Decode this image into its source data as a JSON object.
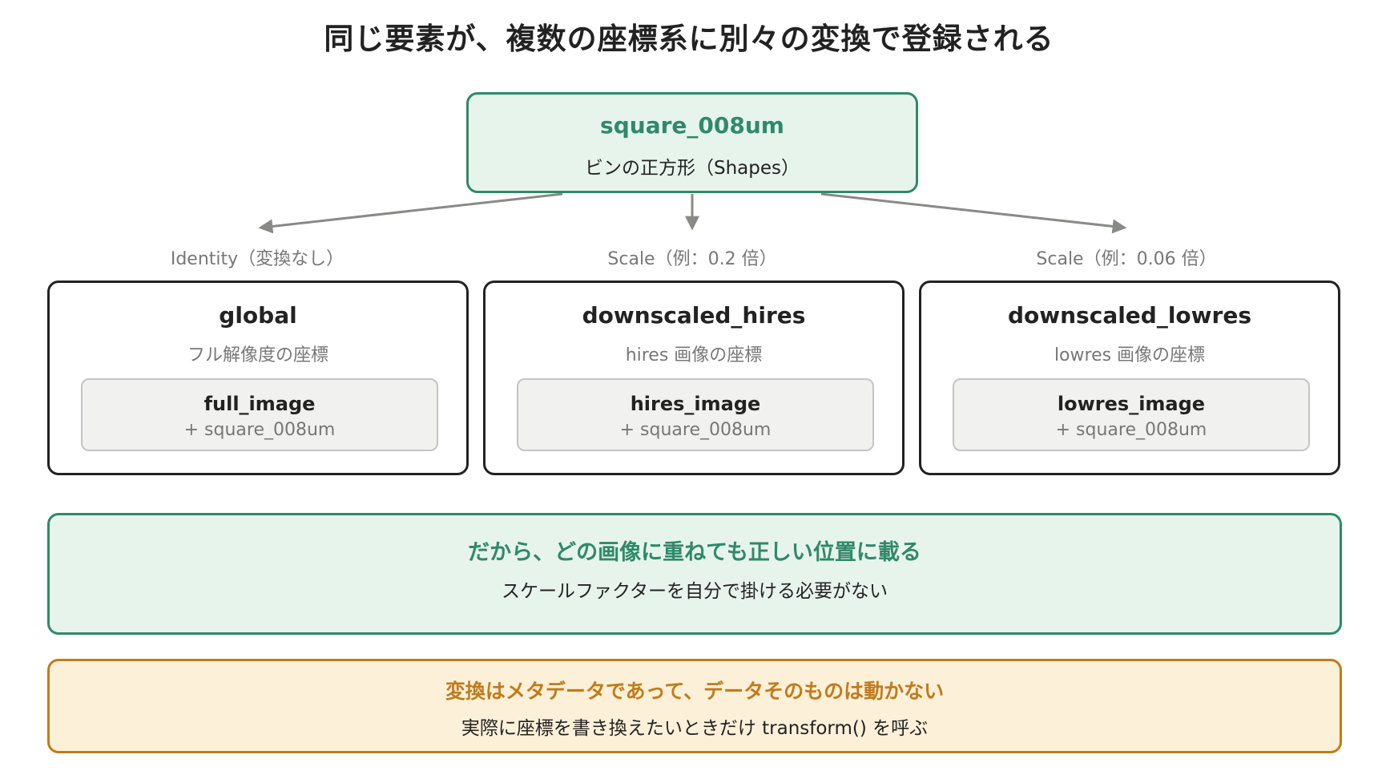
{
  "title": "同じ要素が、複数の座標系に別々の変換で登録される",
  "source": {
    "name": "square_008um",
    "description": "ビンの正方形（Shapes）"
  },
  "transforms": [
    {
      "label": "Identity（変換なし）"
    },
    {
      "label": "Scale（例：0.2 倍）"
    },
    {
      "label": "Scale（例：0.06 倍）"
    }
  ],
  "coordinate_systems": [
    {
      "name": "global",
      "description": "フル解像度の座標",
      "image": "full_image",
      "shape": "+ square_008um"
    },
    {
      "name": "downscaled_hires",
      "description": "hires 画像の座標",
      "image": "hires_image",
      "shape": "+ square_008um"
    },
    {
      "name": "downscaled_lowres",
      "description": "lowres 画像の座標",
      "image": "lowres_image",
      "shape": "+ square_008um"
    }
  ],
  "callout_green": {
    "title": "だから、どの画像に重ねても正しい位置に載る",
    "subtitle": "スケールファクターを自分で掛ける必要がない"
  },
  "callout_orange": {
    "title": "変換はメタデータであって、データそのものは動かない",
    "subtitle": "実際に座標を書き換えたいときだけ transform() を呼ぶ"
  },
  "colors": {
    "accent_green": "#2e8a6a",
    "green_fill": "#e7f4ec",
    "accent_orange": "#c07c1a",
    "orange_fill": "#fdf0d9",
    "arrow": "#888a85"
  }
}
